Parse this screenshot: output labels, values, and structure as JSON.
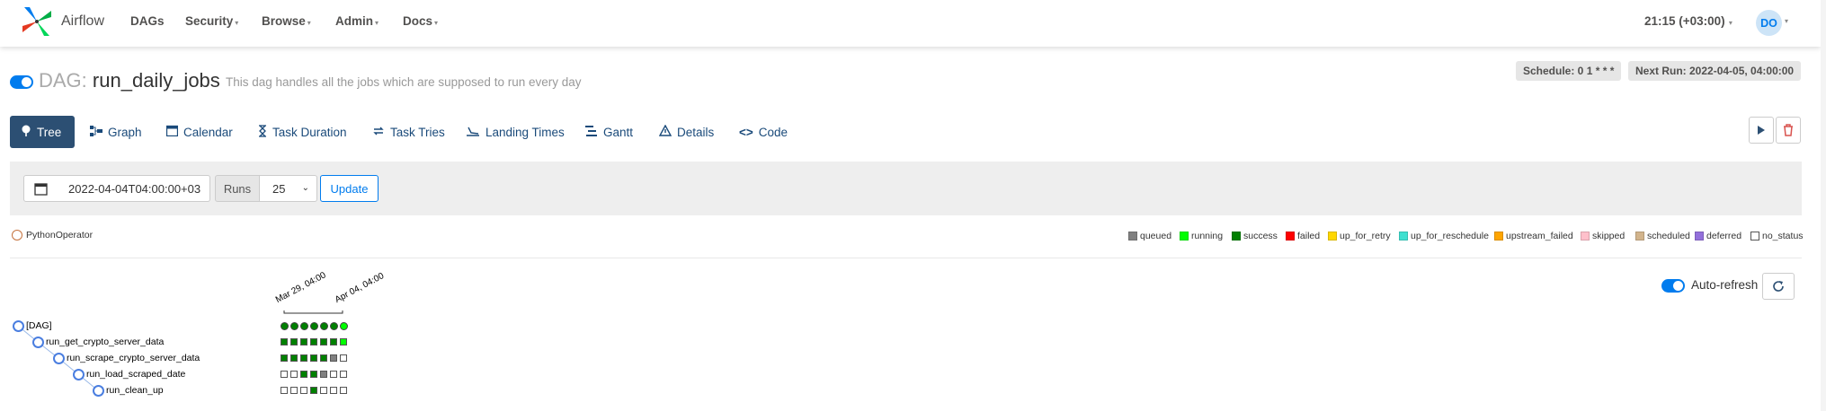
{
  "navbar": {
    "brand": "Airflow",
    "items": [
      "DAGs",
      "Security",
      "Browse",
      "Admin",
      "Docs"
    ],
    "time": "21:15 (+03:00)",
    "user_initials": "DO"
  },
  "dag": {
    "prefix": "DAG:",
    "id": "run_daily_jobs",
    "description": "This dag handles all the jobs which are supposed to run every day",
    "schedule": "Schedule: 0 1 * * *",
    "next_run": "Next Run: 2022-04-05, 04:00:00"
  },
  "tabs": [
    {
      "label": "Tree",
      "icon": "tree-icon",
      "active": true
    },
    {
      "label": "Graph",
      "icon": "graph-icon"
    },
    {
      "label": "Calendar",
      "icon": "calendar-icon"
    },
    {
      "label": "Task Duration",
      "icon": "hourglass-icon"
    },
    {
      "label": "Task Tries",
      "icon": "retry-icon"
    },
    {
      "label": "Landing Times",
      "icon": "landing-icon"
    },
    {
      "label": "Gantt",
      "icon": "gantt-icon"
    },
    {
      "label": "Details",
      "icon": "warning-triangle-icon"
    },
    {
      "label": "Code",
      "icon": "code-icon"
    }
  ],
  "filter": {
    "base_date": "2022-04-04T04:00:00+03",
    "runs_label": "Runs",
    "runs_value": "25",
    "update_label": "Update"
  },
  "legend": {
    "operator": "PythonOperator",
    "states": [
      {
        "label": "queued",
        "color": "#808080"
      },
      {
        "label": "running",
        "color": "#00ff00"
      },
      {
        "label": "success",
        "color": "#008000"
      },
      {
        "label": "failed",
        "color": "#ff0000"
      },
      {
        "label": "up_for_retry",
        "color": "#ffd700"
      },
      {
        "label": "up_for_reschedule",
        "color": "#40e0d0"
      },
      {
        "label": "upstream_failed",
        "color": "#ffa500"
      },
      {
        "label": "skipped",
        "color": "#ffc0cb"
      },
      {
        "label": "scheduled",
        "color": "#d2b48c"
      },
      {
        "label": "deferred",
        "color": "#9370db"
      },
      {
        "label": "no_status",
        "color": "#ffffff"
      }
    ]
  },
  "auto_refresh": {
    "label": "Auto-refresh",
    "enabled": true
  },
  "tree": {
    "dates": [
      "Mar 29, 04:00",
      "Apr 04, 04:00"
    ],
    "nodes": [
      "[DAG]",
      "run_get_crypto_server_data",
      "run_scrape_crypto_server_data",
      "run_load_scraped_date",
      "run_clean_up"
    ],
    "dag_runs": [
      "success",
      "success",
      "success",
      "success",
      "success",
      "success",
      "running"
    ],
    "task_instances": [
      [
        "success",
        "success",
        "success",
        "success",
        "success",
        "success",
        "running"
      ],
      [
        "success",
        "success",
        "success",
        "success",
        "success",
        "queued",
        "no_status"
      ],
      [
        "no_status",
        "no_status",
        "success",
        "success",
        "queued",
        "no_status",
        "no_status"
      ],
      [
        "no_status",
        "no_status",
        "no_status",
        "success",
        "no_status",
        "no_status",
        "no_status"
      ]
    ]
  }
}
